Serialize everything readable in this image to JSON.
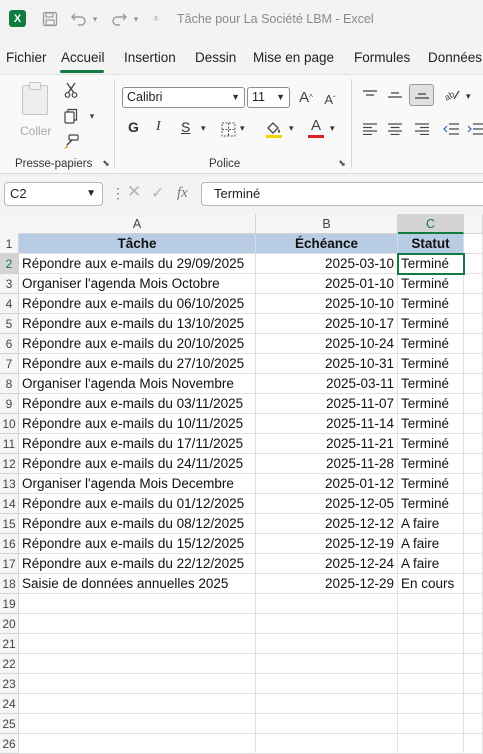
{
  "titlebar": {
    "title": "Tâche pour La Société LBM  -  Excel",
    "logo_letter": "X",
    "icons": [
      "save-icon",
      "undo-icon",
      "redo-icon",
      "customize-qat-icon"
    ]
  },
  "tabs": [
    "Fichier",
    "Accueil",
    "Insertion",
    "Dessin",
    "Mise en page",
    "Formules",
    "Données"
  ],
  "ribbon": {
    "clipboard": {
      "paste_label": "Coller",
      "group_label": "Presse-papiers"
    },
    "font": {
      "font_name": "Calibri",
      "font_size": "11",
      "bold": "G",
      "italic": "I",
      "underline": "S",
      "grow": "A",
      "shrink": "A",
      "font_color_letter": "A",
      "font_color": "#e02020",
      "fill_color": "#f5d300",
      "group_label": "Police"
    }
  },
  "formula_bar": {
    "name_box": "C2",
    "fx": "fx",
    "content": "Terminé"
  },
  "sheet": {
    "columns": [
      "A",
      "B",
      "C"
    ],
    "selected_column": "C",
    "selected_row": "2",
    "header_fill": "#b8cce4",
    "header_row": [
      "Tâche",
      "Échéance",
      "Statut"
    ],
    "rows": [
      [
        "Répondre aux e-mails du 29/09/2025",
        "2025-03-10",
        "Terminé"
      ],
      [
        "Organiser l'agenda Mois Octobre",
        "2025-01-10",
        "Terminé"
      ],
      [
        "Répondre aux e-mails du 06/10/2025",
        "2025-10-10",
        "Terminé"
      ],
      [
        "Répondre aux e-mails du 13/10/2025",
        "2025-10-17",
        "Terminé"
      ],
      [
        "Répondre aux e-mails du 20/10/2025",
        "2025-10-24",
        "Terminé"
      ],
      [
        "Répondre aux e-mails du 27/10/2025",
        "2025-10-31",
        "Terminé"
      ],
      [
        "Organiser l'agenda Mois Novembre",
        "2025-03-11",
        "Terminé"
      ],
      [
        "Répondre aux e-mails du 03/11/2025",
        "2025-11-07",
        "Terminé"
      ],
      [
        "Répondre aux e-mails du 10/11/2025",
        "2025-11-14",
        "Terminé"
      ],
      [
        "Répondre aux e-mails du 17/11/2025",
        "2025-11-21",
        "Terminé"
      ],
      [
        "Répondre aux e-mails du 24/11/2025",
        "2025-11-28",
        "Terminé"
      ],
      [
        "Organiser l'agenda Mois Decembre",
        "2025-01-12",
        "Terminé"
      ],
      [
        "Répondre aux e-mails du 01/12/2025",
        "2025-12-05",
        "Terminé"
      ],
      [
        "Répondre aux e-mails du 08/12/2025",
        "2025-12-12",
        "A faire"
      ],
      [
        "Répondre aux e-mails du 15/12/2025",
        "2025-12-19",
        "A faire"
      ],
      [
        "Répondre aux e-mails du 22/12/2025",
        "2025-12-24",
        "A faire"
      ],
      [
        "Saisie de données annuelles 2025",
        "2025-12-29",
        "En cours"
      ]
    ],
    "row_numbers": [
      "1",
      "2",
      "3",
      "4",
      "5",
      "6",
      "7",
      "8",
      "9",
      "10",
      "11",
      "12",
      "13",
      "14",
      "15",
      "16",
      "17",
      "18",
      "19",
      "20",
      "21",
      "22",
      "23",
      "24",
      "25",
      "26"
    ]
  }
}
